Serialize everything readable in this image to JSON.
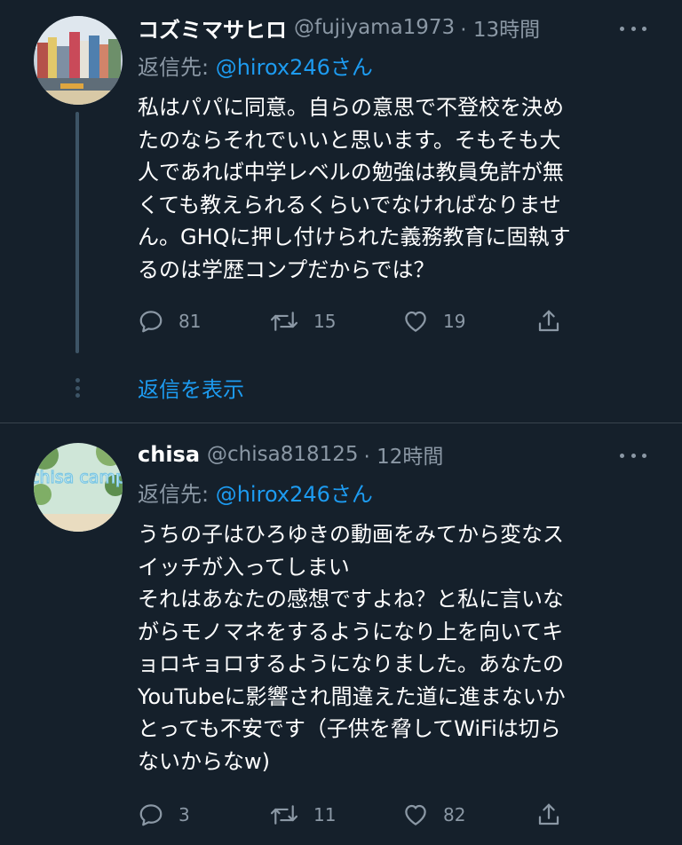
{
  "tweets": [
    {
      "display_name": "コズミマサヒロ",
      "handle": "@fujiyama1973",
      "time": "· 13時間",
      "reply_prefix": "返信先: ",
      "reply_handle": "@hirox246さん",
      "body_lines": [
        "私はパパに同意。自らの意思で不登校を決め",
        "たのならそれでいいと思います。そもそも大",
        "人であれば中学レベルの勉強は教員免許が無",
        "くても教えられるくらいでなければなりませ",
        "ん。GHQに押し付けられた義務教育に固執す",
        "るのは学歴コンプだからでは？"
      ],
      "reply_count": "81",
      "retweet_count": "15",
      "like_count": "19",
      "show_replies": "返信を表示"
    },
    {
      "display_name": "chisa",
      "handle": "@chisa818125",
      "time": "· 12時間",
      "reply_prefix": "返信先: ",
      "reply_handle": "@hirox246さん",
      "avatar_text": "chisa camp",
      "body_lines": [
        "うちの子はひろゆきの動画をみてから変なス",
        "イッチが入ってしまい",
        "それはあなたの感想ですよね？と私に言いな",
        "がらモノマネをするようになり上を向いてキ",
        "ョロキョロするようになりました。あなたの",
        "YouTubeに影響され間違えた道に進まないか",
        "とっても不安です（子供を脅してWiFiは切ら",
        "ないからなw)"
      ],
      "reply_count": "3",
      "retweet_count": "11",
      "like_count": "82"
    }
  ],
  "colors": {
    "background": "#15202b",
    "text_primary": "#ffffff",
    "text_secondary": "#8b98a5",
    "accent": "#1d9bf0",
    "divider": "#38444d"
  },
  "icons": [
    "reply-icon",
    "retweet-icon",
    "like-icon",
    "share-icon",
    "more-icon"
  ]
}
